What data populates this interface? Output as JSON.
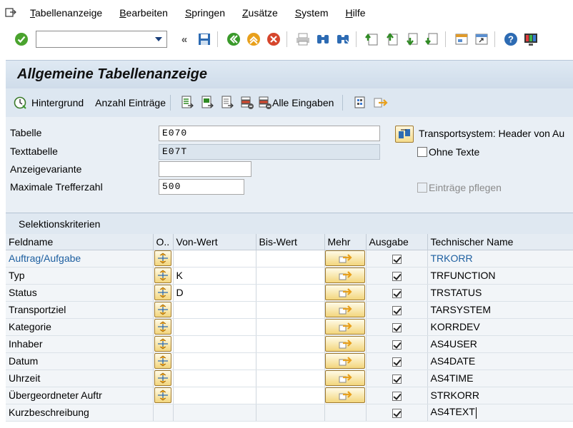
{
  "menu": {
    "items": [
      {
        "label": "Tabellenanzeige",
        "mn": "T",
        "rest": "abellenanzeige"
      },
      {
        "label": "Bearbeiten",
        "mn": "B",
        "rest": "earbeiten"
      },
      {
        "label": "Springen",
        "mn": "S",
        "rest": "pringen"
      },
      {
        "label": "Zusätze",
        "mn": "Z",
        "rest": "usätze"
      },
      {
        "label": "System",
        "mn": "S",
        "rest": "ystem"
      },
      {
        "label": "Hilfe",
        "mn": "H",
        "rest": "ilfe"
      }
    ]
  },
  "toolbar": {
    "command_value": ""
  },
  "title": "Allgemeine Tabellenanzeige",
  "apptoolbar": {
    "hintergrund": "Hintergrund",
    "anzahl": "Anzahl Einträge",
    "alle_eingaben": "Alle Eingaben"
  },
  "form": {
    "tabelle_label": "Tabelle",
    "tabelle_value": "E070",
    "texttabelle_label": "Texttabelle",
    "texttabelle_value": "E07T",
    "anzeigevariante_label": "Anzeigevariante",
    "anzeigevariante_value": "",
    "max_label": "Maximale Trefferzahl",
    "max_value": "500",
    "transport_text": "Transportsystem: Header von Au",
    "ohne_texte": "Ohne Texte",
    "eintraege_pflegen": "Einträge pflegen"
  },
  "selection": {
    "title": "Selektionskriterien",
    "columns": [
      "Feldname",
      "O..",
      "Von-Wert",
      "Bis-Wert",
      "Mehr",
      "Ausgabe",
      "Technischer Name"
    ],
    "rows": [
      {
        "feldname": "Auftrag/Aufgabe",
        "von": "",
        "bis": "",
        "tech": "TRKORR",
        "link": true,
        "buttons": true
      },
      {
        "feldname": "Typ",
        "von": "K",
        "bis": "",
        "tech": "TRFUNCTION",
        "link": false,
        "buttons": true
      },
      {
        "feldname": "Status",
        "von": "D",
        "bis": "",
        "tech": "TRSTATUS",
        "link": false,
        "buttons": true
      },
      {
        "feldname": "Transportziel",
        "von": "",
        "bis": "",
        "tech": "TARSYSTEM",
        "link": false,
        "buttons": true
      },
      {
        "feldname": "Kategorie",
        "von": "",
        "bis": "",
        "tech": "KORRDEV",
        "link": false,
        "buttons": true
      },
      {
        "feldname": "Inhaber",
        "von": "",
        "bis": "",
        "tech": "AS4USER",
        "link": false,
        "buttons": true
      },
      {
        "feldname": "Datum",
        "von": "",
        "bis": "",
        "tech": "AS4DATE",
        "link": false,
        "buttons": true
      },
      {
        "feldname": "Uhrzeit",
        "von": "",
        "bis": "",
        "tech": "AS4TIME",
        "link": false,
        "buttons": true
      },
      {
        "feldname": "Übergeordneter Auftr",
        "von": "",
        "bis": "",
        "tech": "STRKORR",
        "link": false,
        "buttons": true
      },
      {
        "feldname": "Kurzbeschreibung",
        "von": "",
        "bis": "",
        "tech": "AS4TEXT",
        "link": false,
        "buttons": false
      }
    ]
  },
  "colors": {
    "link": "#1d5fa0",
    "title_bg": "#d9e4ef",
    "green_icon": "#3a9a2a"
  }
}
